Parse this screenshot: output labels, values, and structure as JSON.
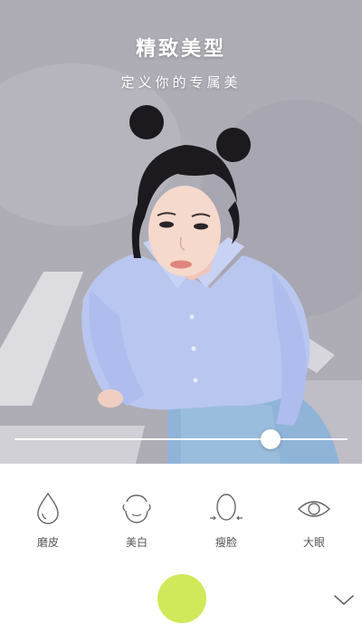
{
  "hero": {
    "title": "精致美型",
    "subtitle": "定义你的专属美"
  },
  "slider": {
    "value": 0.77
  },
  "tools": [
    {
      "id": "smooth",
      "label": "磨皮",
      "icon": "water-drop-icon"
    },
    {
      "id": "whiten",
      "label": "美白",
      "icon": "face-icon"
    },
    {
      "id": "slim",
      "label": "瘦脸",
      "icon": "slim-face-icon"
    },
    {
      "id": "eyes",
      "label": "大眼",
      "icon": "eye-icon"
    }
  ],
  "colors": {
    "shutter": "#cfe95a",
    "label": "#555555",
    "icon": "#666666"
  }
}
